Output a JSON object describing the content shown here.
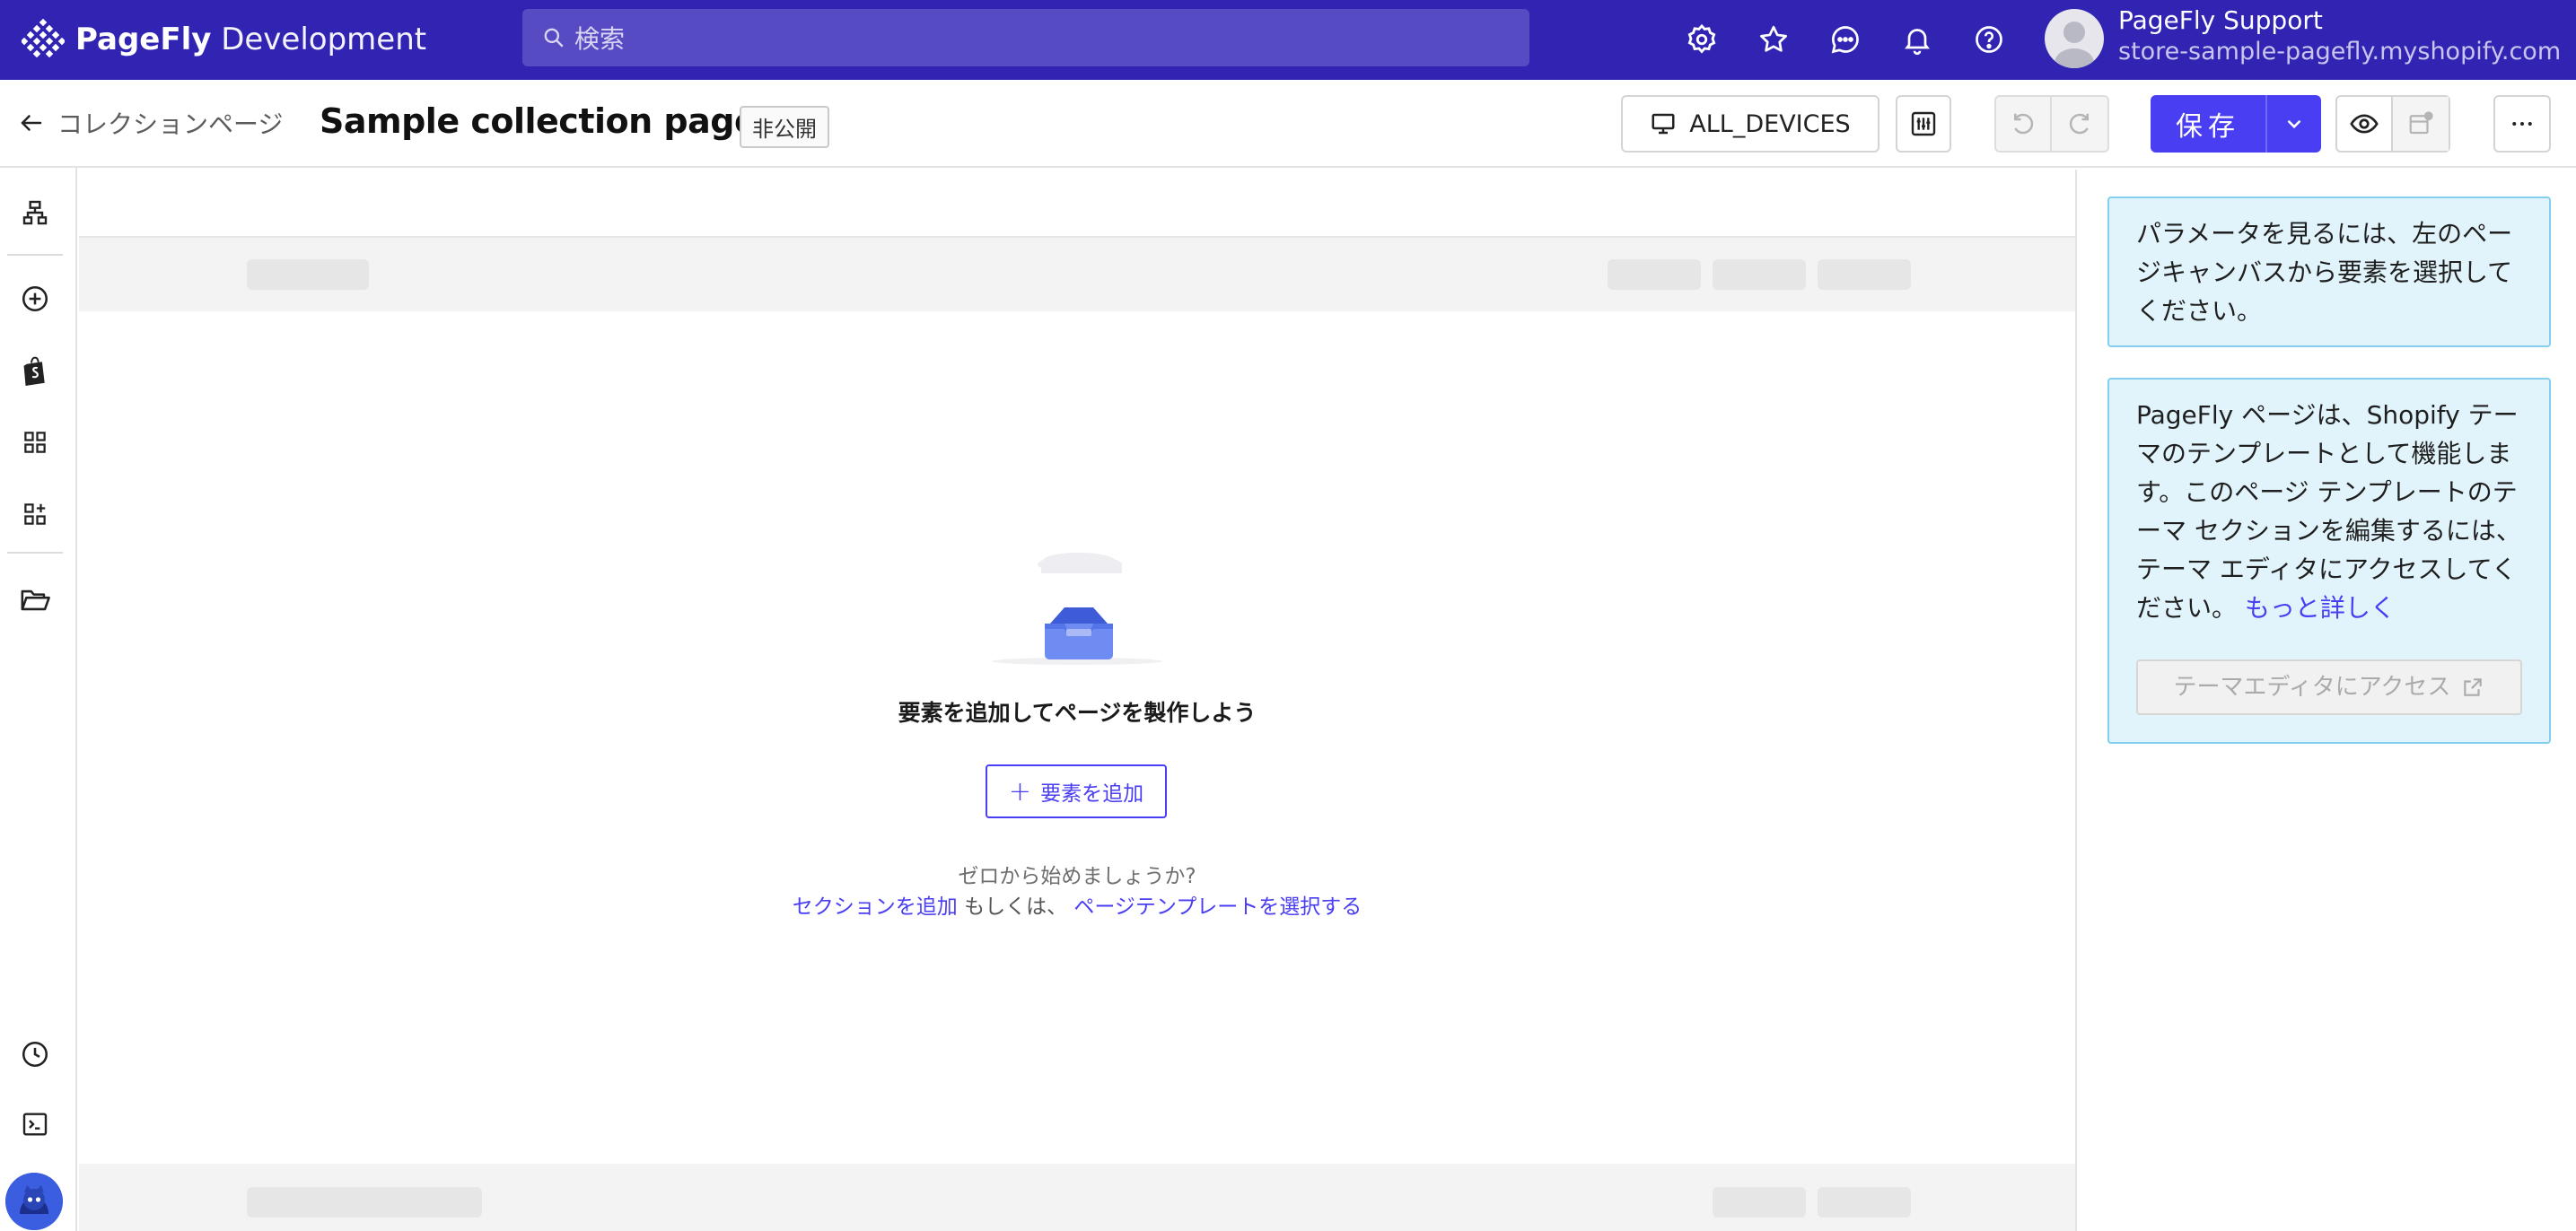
{
  "topbar": {
    "brand": "PageFly",
    "brand_suffix": "Development",
    "search_placeholder": "検索",
    "icons": [
      "settings-icon",
      "star-icon",
      "chat-icon",
      "bell-icon",
      "help-icon"
    ],
    "user": {
      "name": "PageFly Support",
      "store": "store-sample-pagefly.myshopify.com"
    }
  },
  "toolbar": {
    "back_label": "コレクションページ",
    "page_title": "Sample collection page",
    "status": "非公開",
    "device": "ALL_DEVICES",
    "save_label": "保存"
  },
  "rail": {
    "icons": [
      "sitemap-icon",
      "add-circle-icon",
      "shopify-bag-icon",
      "grid-icon",
      "add-grid-icon",
      "folder-open-icon",
      "clock-icon",
      "terminal-icon"
    ]
  },
  "canvas": {
    "empty_title": "要素を追加してページを製作しよう",
    "add_button": "要素を追加",
    "hint": "ゼロから始めましょうか?",
    "link_section": "セクションを追加",
    "or_text": "もしくは、",
    "link_template": "ページテンプレートを選択する"
  },
  "rpanel": {
    "info1": "パラメータを見るには、左のページキャンバスから要素を選択してください。",
    "info2": "PageFly ページは、Shopify テーマのテンプレートとして機能します。このページ テンプレートのテーマ セクションを編集するには、テーマ エディタにアクセスしてください。",
    "learn_more": "もっと詳しく",
    "theme_button": "テーマエディタにアクセス"
  },
  "colors": {
    "brand_bar": "#3124b2",
    "accent": "#4a3ef2",
    "info_bg": "#e1f4fc",
    "info_border": "#82d0ee"
  }
}
